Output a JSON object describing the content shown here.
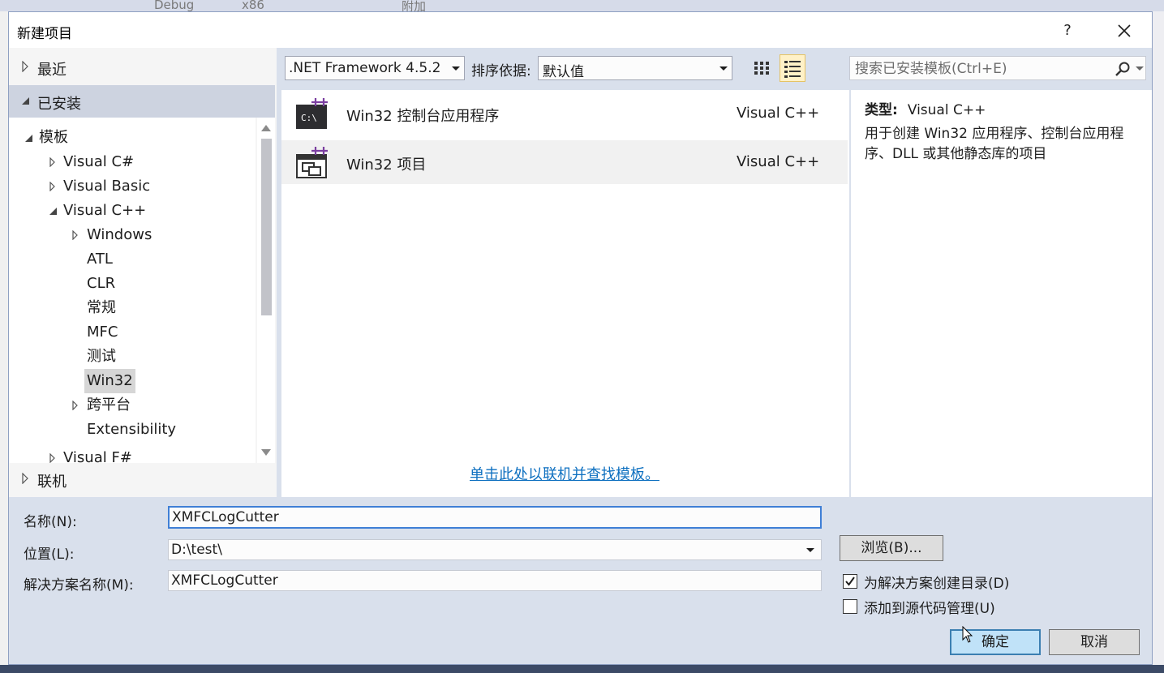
{
  "ide": {
    "toolbar_fragments": [
      "Debug",
      "x86",
      "附加"
    ]
  },
  "dialog": {
    "title": "新建项目",
    "help_label": "?",
    "nav": {
      "recent": "最近",
      "installed": "已安装",
      "online": "联机",
      "tree": {
        "templates": "模板",
        "visual_csharp": "Visual C#",
        "visual_basic": "Visual Basic",
        "visual_cpp": "Visual C++",
        "windows": "Windows",
        "atl": "ATL",
        "clr": "CLR",
        "general": "常规",
        "mfc": "MFC",
        "test": "测试",
        "win32": "Win32",
        "cross_platform": "跨平台",
        "extensibility": "Extensibility",
        "visual_fsharp": "Visual F#"
      }
    },
    "toolbar": {
      "framework": ".NET Framework 4.5.2",
      "sort_label": "排序依据:",
      "sort_value": "默认值",
      "search_placeholder": "搜索已安装模板(Ctrl+E)"
    },
    "templates": [
      {
        "name": "Win32 控制台应用程序",
        "language": "Visual C++",
        "icon": "console-app-icon"
      },
      {
        "name": "Win32 项目",
        "language": "Visual C++",
        "icon": "win32-project-icon"
      }
    ],
    "online_link": "单击此处以联机并查找模板。",
    "description": {
      "type_label": "类型:",
      "type_value": "Visual C++",
      "text": "用于创建 Win32 应用程序、控制台应用程序、DLL 或其他静态库的项目"
    },
    "form": {
      "name_label": "名称(N):",
      "name_value": "XMFCLogCutter",
      "location_label": "位置(L):",
      "location_value": "D:\\test\\",
      "solution_label": "解决方案名称(M):",
      "solution_value": "XMFCLogCutter",
      "browse_label": "浏览(B)...",
      "create_dir_label": "为解决方案创建目录(D)",
      "create_dir_checked": true,
      "source_control_label": "添加到源代码管理(U)",
      "source_control_checked": false,
      "ok_label": "确定",
      "cancel_label": "取消"
    },
    "colors": {
      "accent": "#3c7fb1",
      "link": "#0e70c0",
      "selected_view": "#fff1c7"
    }
  }
}
